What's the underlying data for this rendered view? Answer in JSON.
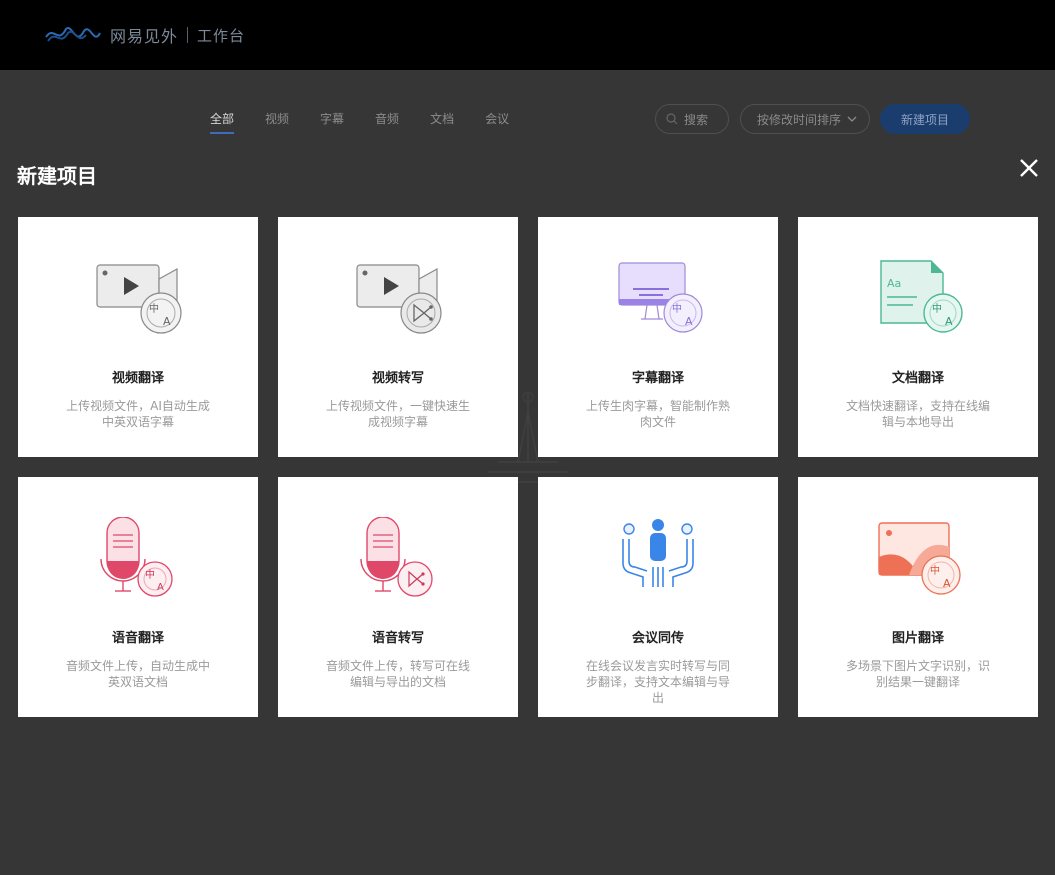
{
  "header": {
    "brand": "网易见外",
    "subtitle": "工作台"
  },
  "tabs": [
    {
      "label": "全部",
      "active": true
    },
    {
      "label": "视频",
      "active": false
    },
    {
      "label": "字幕",
      "active": false
    },
    {
      "label": "音频",
      "active": false
    },
    {
      "label": "文档",
      "active": false
    },
    {
      "label": "会议",
      "active": false
    }
  ],
  "toolbar": {
    "search_placeholder": "搜索",
    "sort_label": "按修改时间排序",
    "new_project_label": "新建项目"
  },
  "modal": {
    "title": "新建项目",
    "cards": [
      {
        "title": "视频翻译",
        "desc": "上传视频文件，AI自动生成中英双语字幕",
        "icon": "video-translate-icon"
      },
      {
        "title": "视频转写",
        "desc": "上传视频文件，一键快速生成视频字幕",
        "icon": "video-transcribe-icon"
      },
      {
        "title": "字幕翻译",
        "desc": "上传生肉字幕，智能制作熟肉文件",
        "icon": "subtitle-translate-icon"
      },
      {
        "title": "文档翻译",
        "desc": "文档快速翻译，支持在线编辑与本地导出",
        "icon": "document-translate-icon"
      },
      {
        "title": "语音翻译",
        "desc": "音频文件上传，自动生成中英双语文档",
        "icon": "audio-translate-icon"
      },
      {
        "title": "语音转写",
        "desc": "音频文件上传，转写可在线编辑与导出的文档",
        "icon": "audio-transcribe-icon"
      },
      {
        "title": "会议同传",
        "desc": "在线会议发言实时转写与同步翻译，支持文本编辑与导出",
        "icon": "meeting-interpret-icon"
      },
      {
        "title": "图片翻译",
        "desc": "多场景下图片文字识别，识别结果一键翻译",
        "icon": "image-translate-icon"
      }
    ]
  },
  "colors": {
    "overlay": "#363636",
    "topbar": "#000000",
    "accent": "#1b3d6e",
    "card_bg": "#ffffff"
  }
}
